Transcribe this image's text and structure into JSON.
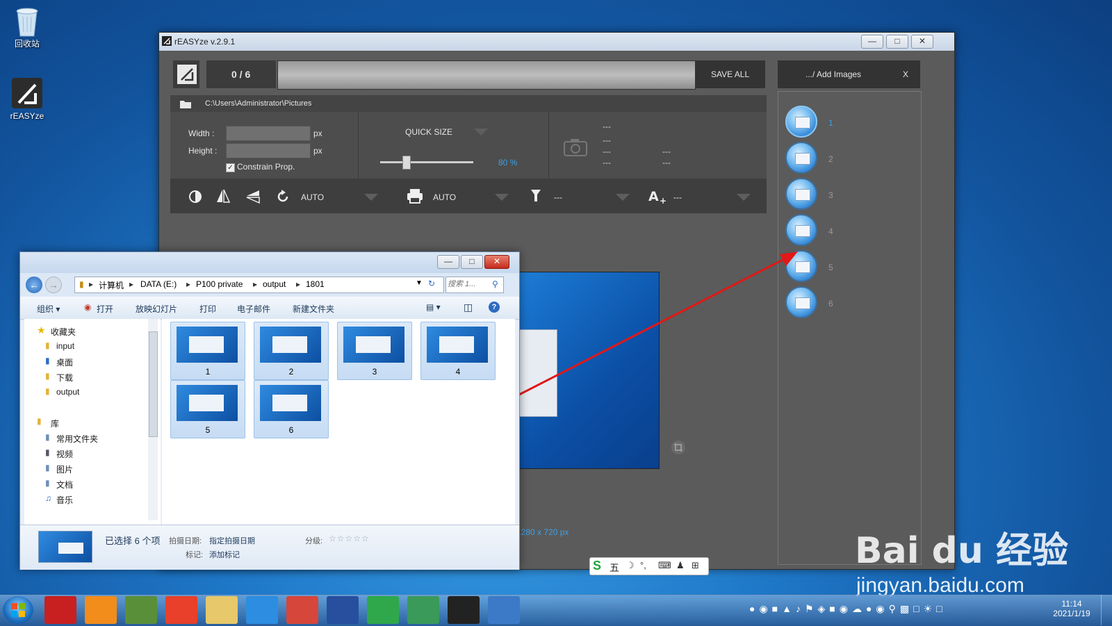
{
  "desktop": {
    "icons": [
      {
        "label": "回收站",
        "icon": "recycle-bin-icon"
      },
      {
        "label": "rEASYze",
        "icon": "reasyze-icon"
      }
    ]
  },
  "reasyze": {
    "title": "rEASYze v.2.9.1",
    "progress_text": "0 / 6",
    "save_all": "SAVE ALL",
    "add_images": ".../ Add Images",
    "close_x": "X",
    "path": "C:\\Users\\Administrator\\Pictures",
    "width_label": "Width :",
    "height_label": "Height :",
    "px1": "px",
    "px2": "px",
    "constrain": "Constrain Prop.",
    "quick_size": "QUICK SIZE",
    "percent": "80 %",
    "quick_size_value": 0.8,
    "info": [
      "---",
      "---",
      "---",
      "---",
      "---",
      "---"
    ],
    "rotate_auto": "AUTO",
    "print_auto": "AUTO",
    "filter_val": "---",
    "text_val": "---",
    "dimensions": "1280 x 720 px",
    "thumbs": [
      "1",
      "2",
      "3",
      "4",
      "5",
      "6"
    ],
    "accent": "#3aa0e8"
  },
  "explorer": {
    "breadcrumb": [
      "计算机",
      "DATA (E:)",
      "P100 private",
      "output",
      "1801"
    ],
    "search_placeholder": "搜索 1...",
    "toolbar": [
      "组织 ▾",
      "打开",
      "放映幻灯片",
      "打印",
      "电子邮件",
      "新建文件夹"
    ],
    "tree": {
      "favorites": "收藏夹",
      "fav_items": [
        "input",
        "桌面",
        "下载",
        "output"
      ],
      "library": "库",
      "lib_items": [
        "常用文件夹",
        "视频",
        "图片",
        "文档",
        "音乐"
      ]
    },
    "files": [
      "1",
      "2",
      "3",
      "4",
      "5",
      "6"
    ],
    "status": {
      "selected": "已选择 6 个项",
      "date_label": "拍摄日期:",
      "date_value": "指定拍摄日期",
      "rating_label": "分级:",
      "tag_label": "标记:",
      "tag_value": "添加标记",
      "stars": 0
    }
  },
  "ime": {
    "text": "五"
  },
  "watermark": {
    "brand": "Bai du 经验",
    "url": "jingyan.baidu.com"
  },
  "taskbar": {
    "time": "11:14",
    "date": "2021/1/19"
  }
}
